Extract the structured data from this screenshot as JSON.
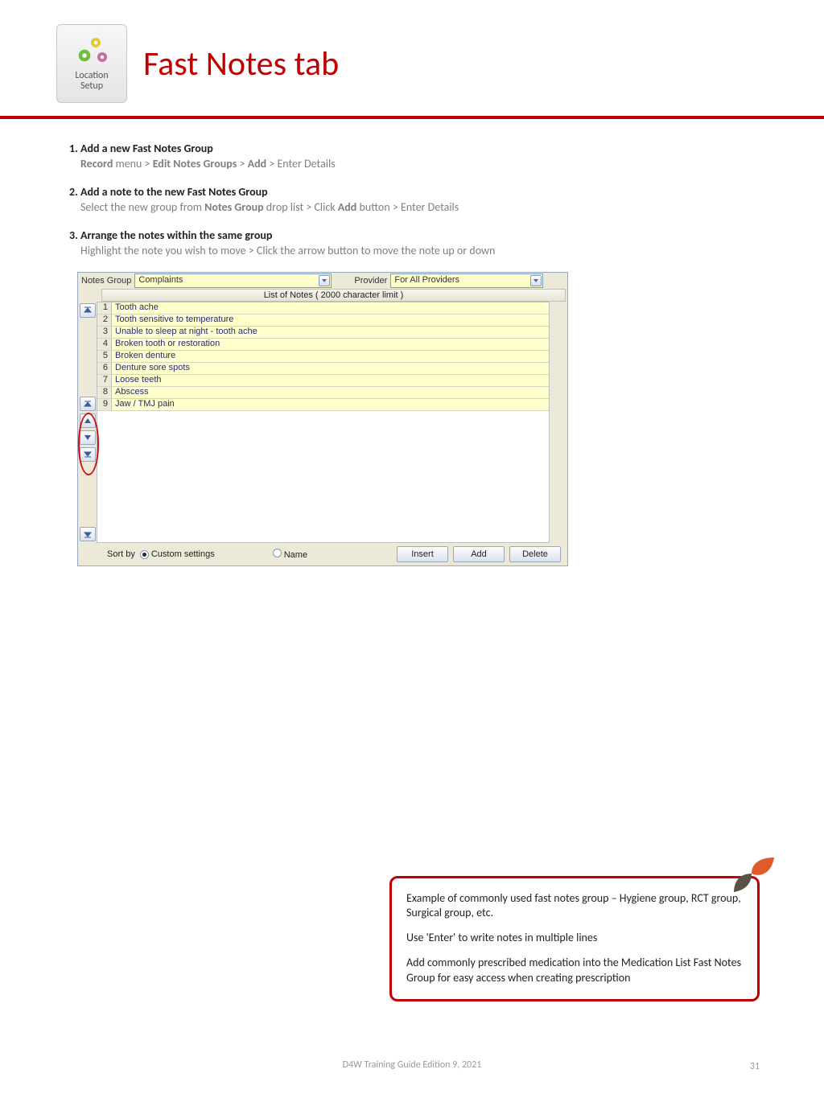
{
  "header": {
    "icon_caption_line1": "Location",
    "icon_caption_line2": "Setup",
    "title": "Fast Notes tab"
  },
  "steps": [
    {
      "title": "Add a new Fast Notes Group",
      "detail_parts": [
        "Record",
        " menu > ",
        "Edit Notes Groups",
        " > ",
        "Add",
        " > Enter Details"
      ]
    },
    {
      "title": "Add a note to the new Fast Notes Group",
      "detail_parts": [
        "Select the new group from ",
        "Notes Group",
        " drop list > Click ",
        "Add",
        " button > Enter Details"
      ]
    },
    {
      "title": "Arrange the notes within the same group",
      "detail_parts": [
        "Highlight the note you wish to move > Click the arrow button to move the note up or down"
      ]
    }
  ],
  "screenshot": {
    "notes_group_label": "Notes Group",
    "notes_group_value": "Complaints",
    "provider_label": "Provider",
    "provider_value": "For All Providers",
    "list_header": "List of Notes ( 2000 character limit )",
    "rows": [
      "Tooth ache",
      "Tooth sensitive to temperature",
      "Unable to sleep at night - tooth ache",
      "Broken tooth or restoration",
      "Broken denture",
      "Denture sore spots",
      "Loose teeth",
      "Abscess",
      "Jaw / TMJ pain"
    ],
    "sort_by_label": "Sort by",
    "radio_custom": "Custom settings",
    "radio_name": "Name",
    "btn_insert": "Insert",
    "btn_add": "Add",
    "btn_delete": "Delete"
  },
  "callout": {
    "p1": "Example of commonly used fast notes group – Hygiene group, RCT group, Surgical group, etc.",
    "p2": "Use 'Enter' to write notes in multiple lines",
    "p3": "Add commonly prescribed medication into the Medication List Fast Notes Group for easy access when creating prescription"
  },
  "footer": {
    "text": "D4W Training Guide Edition 9, 2021",
    "page": "31"
  }
}
